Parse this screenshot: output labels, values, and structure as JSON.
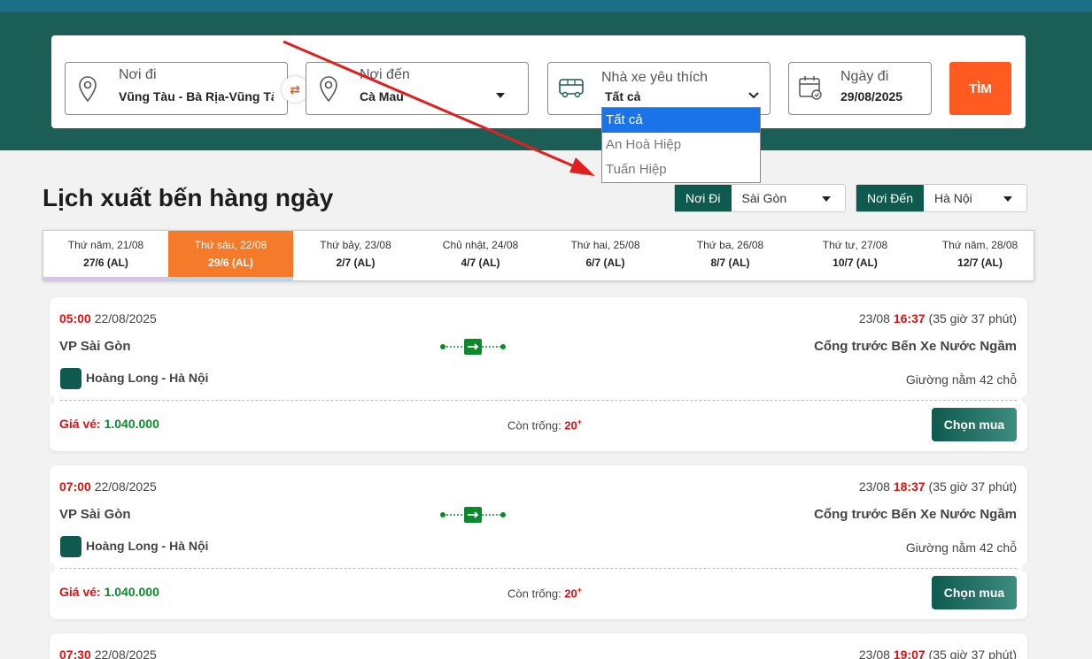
{
  "search": {
    "from_label": "Nơi đi",
    "from_value": "Vũng Tàu - Bà Rịa-Vũng Tàu",
    "to_label": "Nơi đến",
    "to_value": "Cà Mau",
    "operator_label": "Nhà xe yêu thích",
    "operator_value": "Tất cả",
    "date_label": "Ngày đi",
    "date_value": "29/08/2025",
    "search_button": "TÌM"
  },
  "operator_dropdown": {
    "options": [
      "Tất cả",
      "An Hoà Hiệp",
      "Tuấn Hiệp"
    ]
  },
  "section_title": "Lịch xuất bến hàng ngày",
  "filters": {
    "from_tag": "Nơi Đi",
    "from_value": "Sài Gòn",
    "to_tag": "Nơi Đến",
    "to_value": "Hà Nội"
  },
  "days": [
    {
      "day": "Thứ năm, 21/08",
      "lunar": "27/6 (AL)"
    },
    {
      "day": "Thứ sáu, 22/08",
      "lunar": "29/6 (AL)"
    },
    {
      "day": "Thứ bảy, 23/08",
      "lunar": "2/7 (AL)"
    },
    {
      "day": "Chủ nhật, 24/08",
      "lunar": "4/7 (AL)"
    },
    {
      "day": "Thứ hai, 25/08",
      "lunar": "6/7 (AL)"
    },
    {
      "day": "Thứ ba, 26/08",
      "lunar": "8/7 (AL)"
    },
    {
      "day": "Thứ tư, 27/08",
      "lunar": "10/7 (AL)"
    },
    {
      "day": "Thứ năm, 28/08",
      "lunar": "12/7 (AL)"
    }
  ],
  "trips": [
    {
      "depart_time": "05:00",
      "depart_date": "22/08/2025",
      "arrive_date": "23/08",
      "arrive_time": "16:37",
      "duration": "(35 giờ 37 phút)",
      "from": "VP Sài Gòn",
      "to": "Cổng trước Bến Xe Nước Ngầm",
      "operator": "Hoàng Long - Hà Nội",
      "bus_type": "Giường nằm 42 chỗ",
      "price_label": "Giá vé:",
      "price": "1.040.000",
      "seats_label": "Còn trống:",
      "seats": "20",
      "seats_plus": "+",
      "buy_label": "Chọn mua"
    },
    {
      "depart_time": "07:00",
      "depart_date": "22/08/2025",
      "arrive_date": "23/08",
      "arrive_time": "18:37",
      "duration": "(35 giờ 37 phút)",
      "from": "VP Sài Gòn",
      "to": "Cổng trước Bến Xe Nước Ngầm",
      "operator": "Hoàng Long - Hà Nội",
      "bus_type": "Giường nằm 42 chỗ",
      "price_label": "Giá vé:",
      "price": "1.040.000",
      "seats_label": "Còn trống:",
      "seats": "20",
      "seats_plus": "+",
      "buy_label": "Chọn mua"
    },
    {
      "depart_time": "07:30",
      "depart_date": "22/08/2025",
      "arrive_date": "23/08",
      "arrive_time": "19:07",
      "duration": "(35 giờ 37 phút)"
    }
  ],
  "colors": {
    "brand_green": "#0e5a4e",
    "search_orange": "#ff5a1f",
    "active_day": "#f57a2a",
    "annotation_arrow": "#e02020"
  }
}
